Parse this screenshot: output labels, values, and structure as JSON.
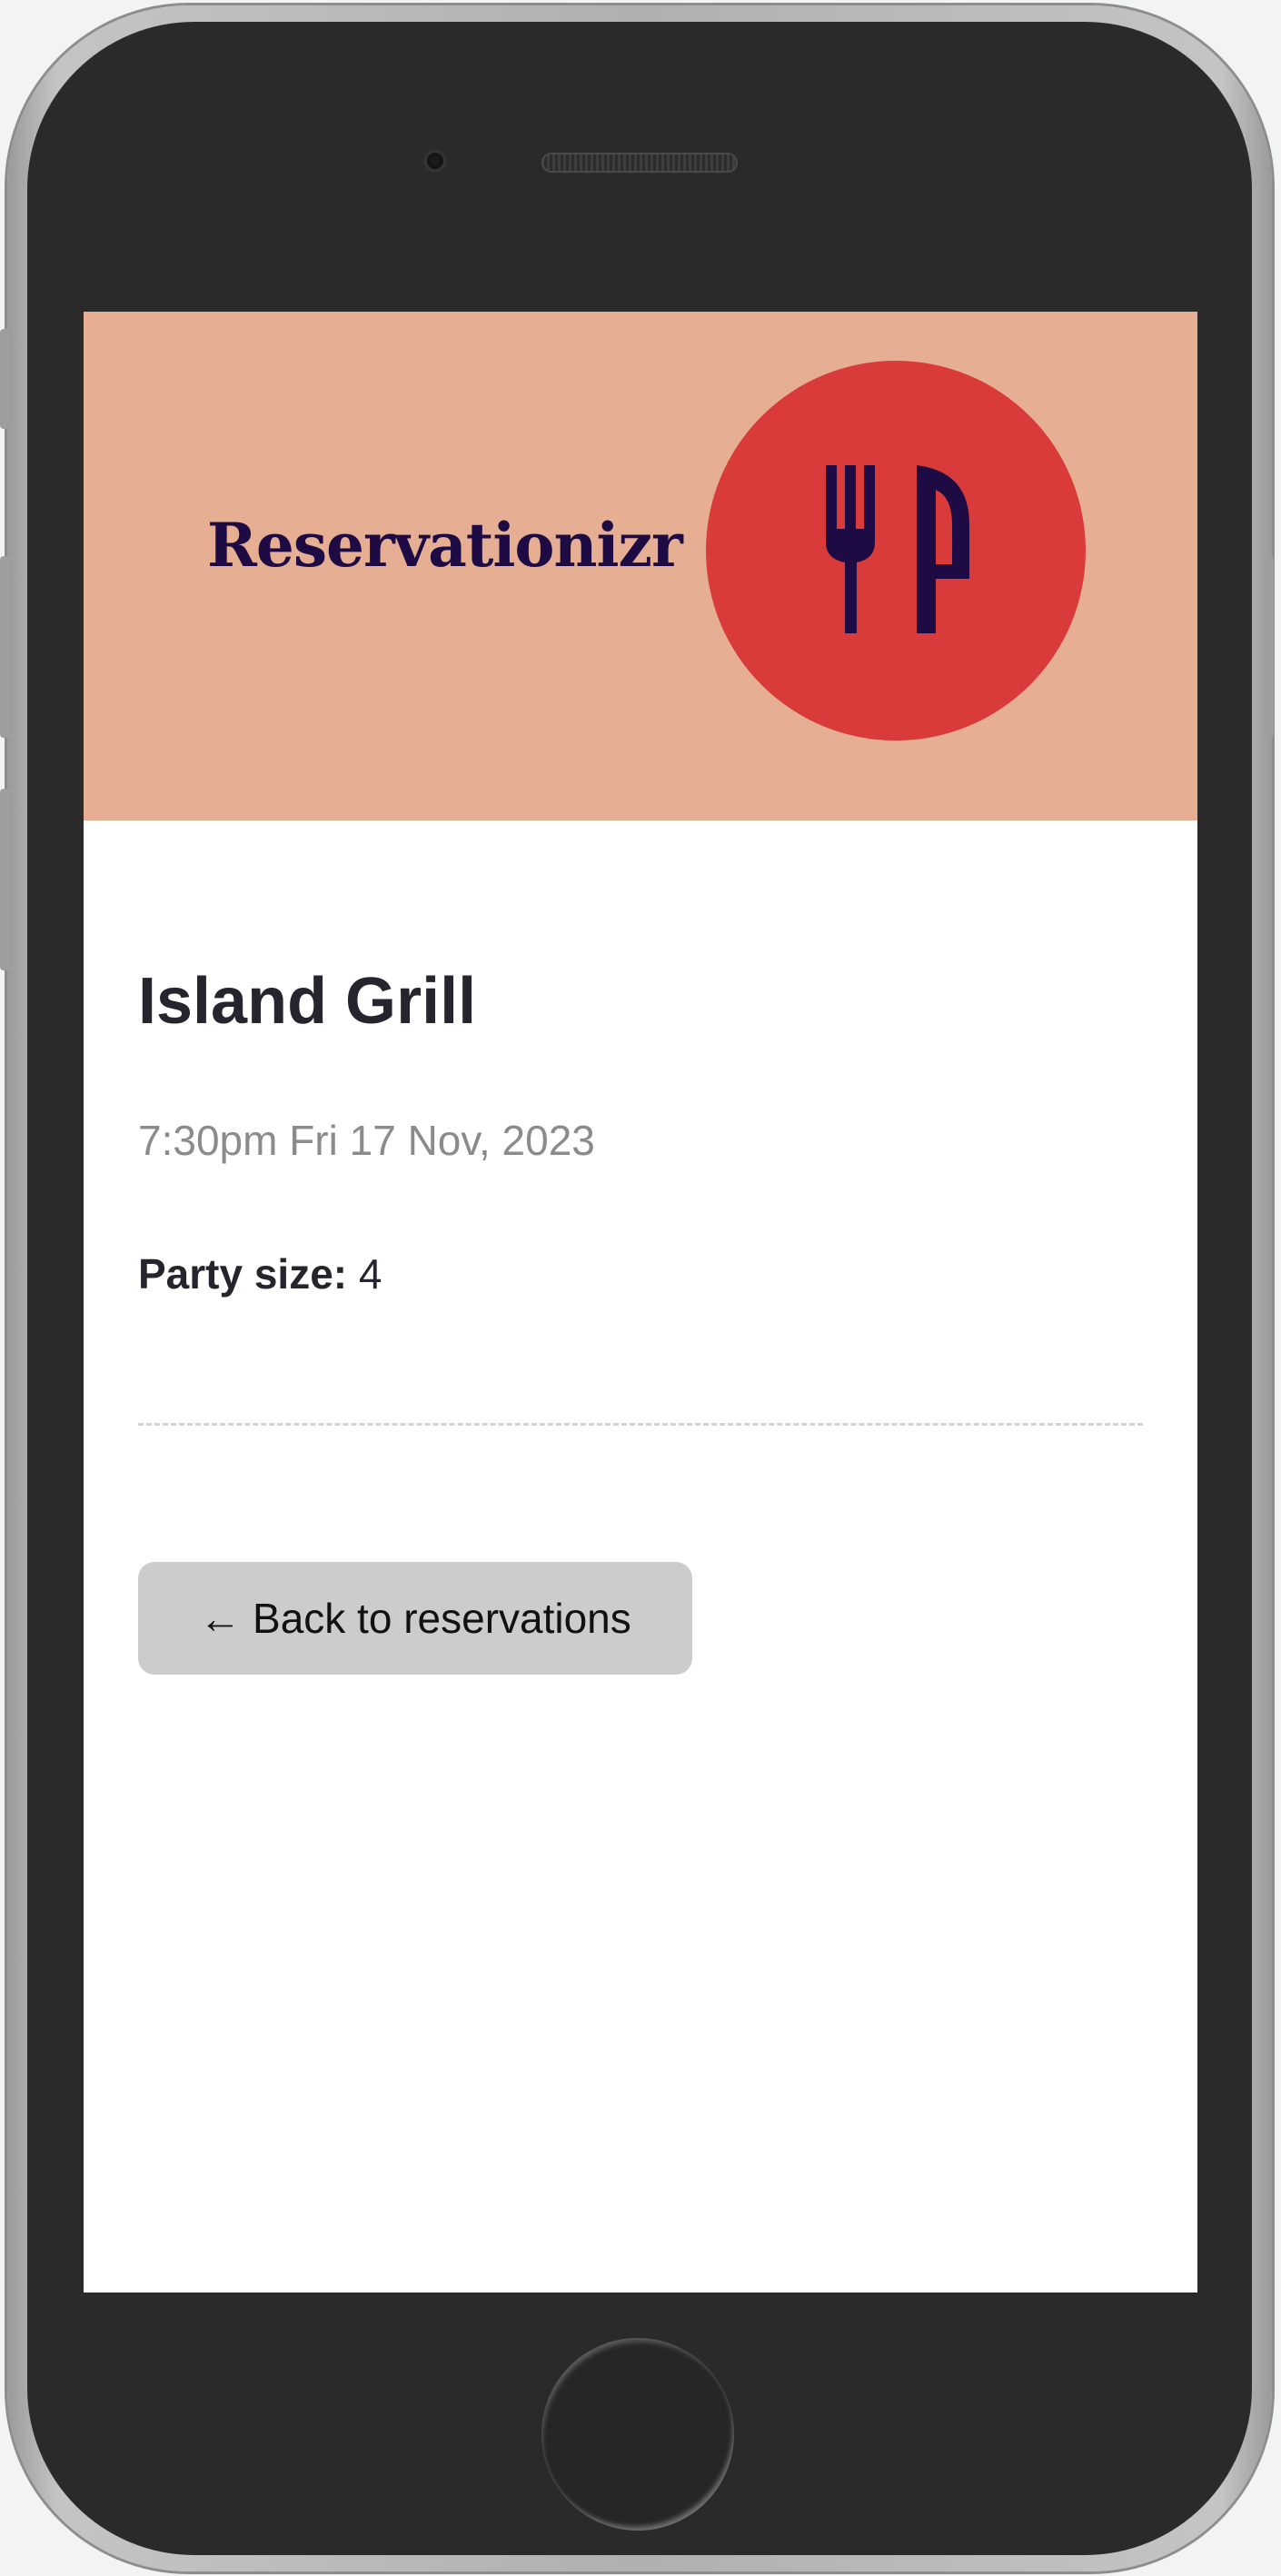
{
  "app": {
    "brand_name": "Reservationizr",
    "logo_icon": "fork-knife-logo-icon"
  },
  "reservation": {
    "restaurant_name": "Island Grill",
    "datetime": "7:30pm Fri 17 Nov, 2023",
    "party_size_label": "Party size:",
    "party_size_value": "4"
  },
  "actions": {
    "back_label": "← Back to reservations"
  },
  "colors": {
    "header_bg": "#e6af94",
    "logo_bg": "#d93a3a",
    "brand_text": "#1e0b43",
    "button_bg": "#cccccc"
  }
}
